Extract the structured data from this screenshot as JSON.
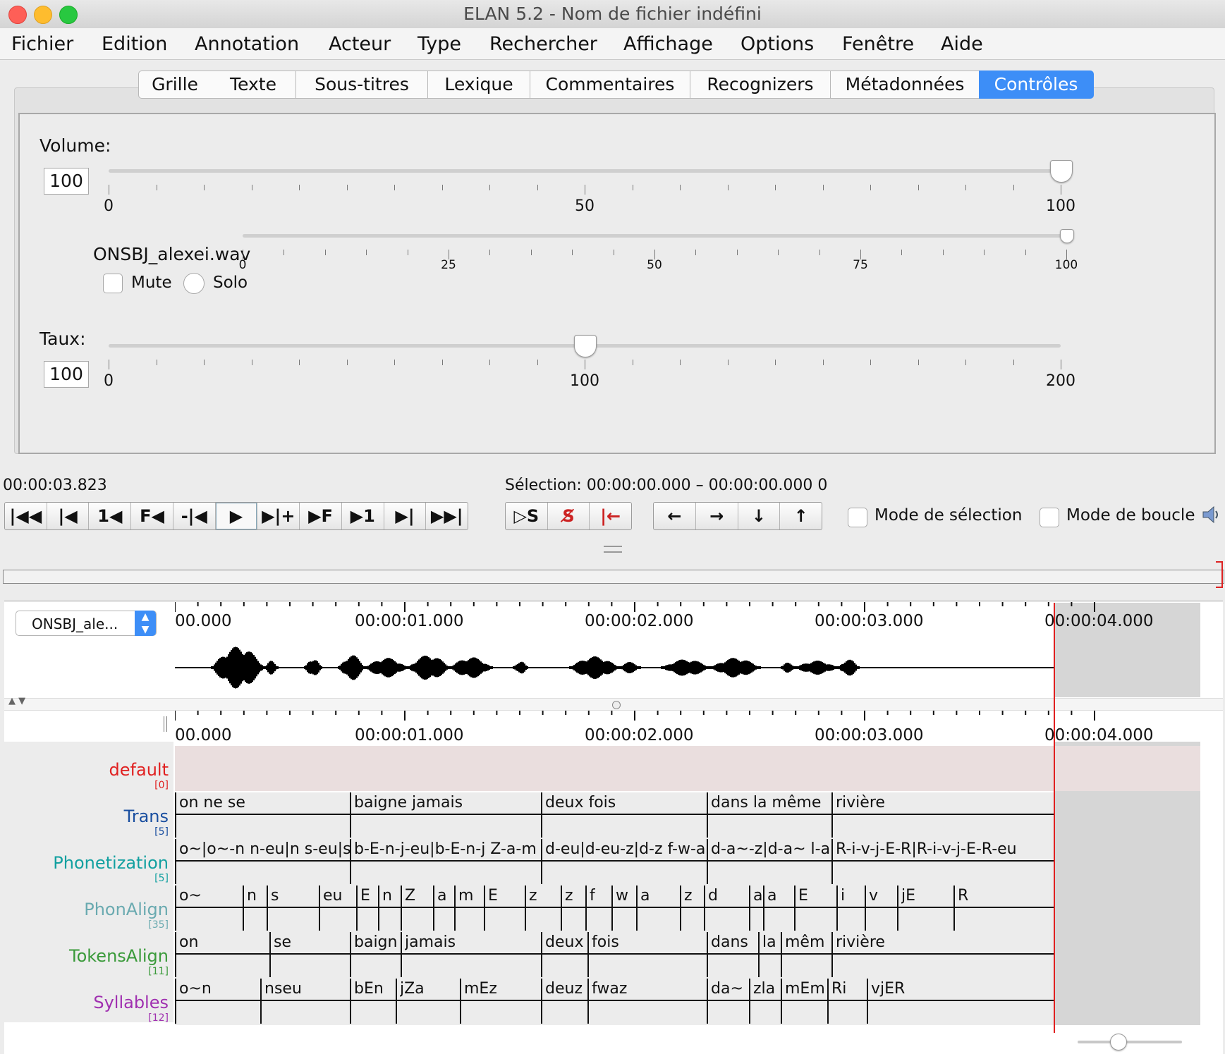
{
  "window": {
    "title": "ELAN 5.2 - Nom de fichier indéfini"
  },
  "menu": [
    "Fichier",
    "Edition",
    "Annotation",
    "Acteur",
    "Type",
    "Rechercher",
    "Affichage",
    "Options",
    "Fenêtre",
    "Aide"
  ],
  "tabs": [
    "Grille",
    "Texte",
    "Sous-titres",
    "Lexique",
    "Commentaires",
    "Recognizers",
    "Métadonnées",
    "Contrôles"
  ],
  "active_tab": "Contrôles",
  "controls": {
    "volume": {
      "label": "Volume:",
      "value": "100",
      "ticks": [
        "0",
        "50",
        "100"
      ],
      "level": 1.0
    },
    "track": {
      "name": "ONSBJ_alexei.wav",
      "mute_label": "Mute",
      "solo_label": "Solo",
      "ticks": [
        "0",
        "25",
        "50",
        "75",
        "100"
      ],
      "level": 1.0
    },
    "rate": {
      "label": "Taux:",
      "value": "100",
      "ticks": [
        "0",
        "100",
        "200"
      ],
      "level": 0.5
    }
  },
  "transport": {
    "time": "00:00:03.823",
    "selection": "Sélection: 00:00:00.000 – 00:00:00.000  0",
    "selection_mode": "Mode de sélection",
    "loop_mode": "Mode de boucle",
    "buttons": [
      "|◀◀",
      "|◀",
      "1◀",
      "F◀",
      "-|◀",
      "▶",
      "▶|+",
      "▶F",
      "▶1",
      "▶|",
      "▶▶|"
    ],
    "sel_buttons": [
      "▷S",
      "S̸",
      "|←"
    ],
    "nav_buttons": [
      "←",
      "→",
      "↓",
      "↑"
    ]
  },
  "timeline": {
    "media_select": "ONSBJ_ale...",
    "ruler": [
      "00.000",
      "00:00:01.000",
      "00:00:02.000",
      "00:00:03.000",
      "00:00:04.000"
    ],
    "tiers": [
      {
        "name": "default",
        "count": "[0]",
        "color": "#e02020"
      },
      {
        "name": "Trans",
        "count": "[5]",
        "color": "#1a4fa0"
      },
      {
        "name": "Phonetization",
        "count": "[5]",
        "color": "#12a0a0"
      },
      {
        "name": "PhonAlign",
        "count": "[35]",
        "color": "#6aaab0"
      },
      {
        "name": "TokensAlign",
        "count": "[11]",
        "color": "#3a9a3a"
      },
      {
        "name": "Syllables",
        "count": "[12]",
        "color": "#a030b0"
      }
    ],
    "annotations": {
      "Trans": [
        "on ne se",
        "baigne jamais",
        "deux fois",
        "dans la même",
        "rivière"
      ],
      "Phonetization": [
        "o~|o~-n n-eu|n s-eu|s",
        "b-E-n-j-eu|b-E-n-j Z-a-m",
        "d-eu|d-eu-z|d-z f-w-a",
        "d-a~-z|d-a~ l-a",
        "R-i-v-j-E-R|R-i-v-j-E-R-eu"
      ],
      "PhonAlign": [
        "o~",
        "n",
        "s",
        "eu",
        "E",
        "n",
        "Z",
        "a",
        "m",
        "E",
        "z",
        "z",
        "f",
        "w",
        "a",
        "z",
        "d",
        "a",
        "a",
        "E",
        "i",
        "v",
        "jE",
        "R"
      ],
      "TokensAlign": [
        "on",
        "se",
        "baign",
        "jamais",
        "deux",
        "fois",
        "dans",
        "la",
        "mêm",
        "rivière"
      ],
      "Syllables": [
        "o~n",
        "nseu",
        "bEn",
        "jZa",
        "mEz",
        "deuz",
        "fwaz",
        "da~",
        "zla",
        "mEm",
        "Ri",
        "vjER"
      ]
    }
  }
}
